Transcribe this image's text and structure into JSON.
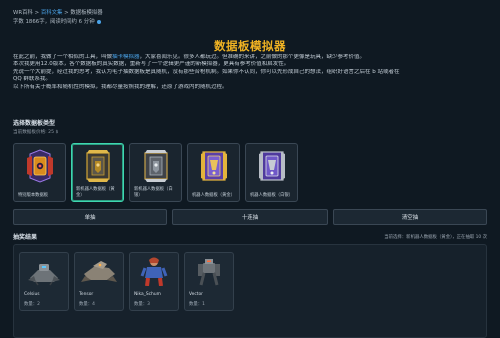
{
  "breadcrumb": {
    "wiki": "WR百科",
    "sep1": " > ",
    "section": "百科文集",
    "sep2": " > ",
    "current": "数据板模拟器"
  },
  "meta": {
    "text": "字数 1866字，阅读时间约 6 分钟"
  },
  "page": {
    "title": "数据板模拟器"
  },
  "intro": {
    "line1_a": "在此之前，我做了一个相似的工具，叫做",
    "line1_link": "抽卡模拟器",
    "line1_b": "，大家喜闻乐见。很多人都玩过。但准确的来讲，之前做的那个更像是玩具，缺少参考价值。",
    "line2": "本次我更用12.0版本，各个数据板的真实数据，重新写了一个逻辑更严谨的新模拟器，更具有参考价值和启发性。",
    "line3": "先说一个大前提，经过我的思考，我认为毛子抽数据板是真随机，没有那些合枪机制。如果你不认同，你可以先形成自己的想法，组织好语言之后在 b 站或者在",
    "line4": "QQ 群联系我。",
    "line5": "以下所有关于概率和随机性的模拟，我都尽量按照我的理解，还原了游戏内的随机过程。"
  },
  "select_section": {
    "heading": "选择数据板类型",
    "current": "当前数据板价格: 25 $"
  },
  "boards": [
    {
      "label": "特别版本数据板",
      "selected": false
    },
    {
      "label": "新机器人数据板（黄金）",
      "selected": true
    },
    {
      "label": "新机器人数据板（白银）",
      "selected": false
    },
    {
      "label": "机器人数据板（黄金）",
      "selected": false
    },
    {
      "label": "机器人数据板（白银）",
      "selected": false
    }
  ],
  "actions": {
    "single": "单抽",
    "ten": "十连抽",
    "reset": "清空抽"
  },
  "results": {
    "heading": "抽奖结果",
    "status": "当前选择：新机器人数据板（黄金），正在抽取 10 次",
    "items": [
      {
        "name": "Celsius",
        "count": "数量：2"
      },
      {
        "name": "Tensor",
        "count": "数量：4"
      },
      {
        "name": "Nika_Schum",
        "count": "数量：3"
      },
      {
        "name": "Vector",
        "count": "数量：1"
      }
    ]
  },
  "colors": {
    "background": "#0f1922",
    "title": "#f0b323",
    "link": "#4aa3e8",
    "selected_border": "#3fd6b0"
  }
}
